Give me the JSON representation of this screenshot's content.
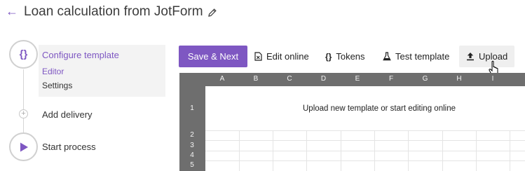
{
  "header": {
    "back_icon": "arrow-left-icon",
    "title": "Loan calculation from JotForm",
    "edit_icon": "pencil-icon"
  },
  "steps": {
    "configure": {
      "icon": "{}",
      "label": "Configure template",
      "sub": [
        "Editor",
        "Settings"
      ]
    },
    "delivery": {
      "label": "Add delivery"
    },
    "process": {
      "label": "Start process"
    }
  },
  "toolbar": {
    "save_next": "Save & Next",
    "edit_online": "Edit online",
    "tokens": "Tokens",
    "test_template": "Test template",
    "upload": "Upload"
  },
  "grid": {
    "columns": [
      "A",
      "B",
      "C",
      "D",
      "E",
      "F",
      "G",
      "H",
      "I"
    ],
    "rows": [
      "1",
      "2",
      "3",
      "4",
      "5"
    ],
    "message": "Upload new template or start editing online"
  },
  "colors": {
    "accent": "#7e57c2",
    "grid_header": "#6e6e6e"
  }
}
